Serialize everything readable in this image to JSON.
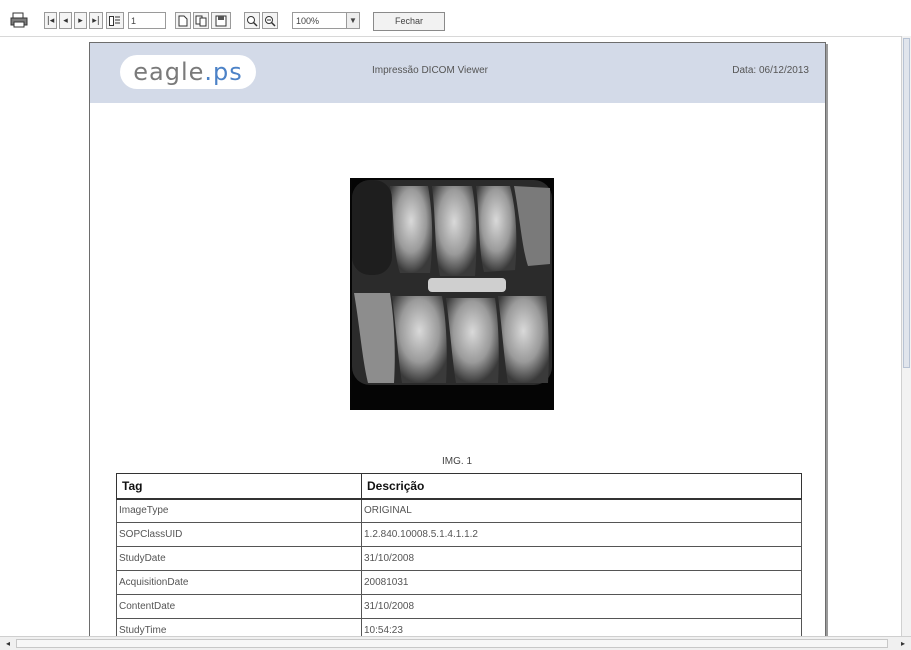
{
  "toolbar": {
    "page_number": "1",
    "zoom_value": "100%",
    "close_label": "Fechar",
    "nav_first": "|◂",
    "nav_prev": "◂",
    "nav_next": "▸",
    "nav_last": "▸|"
  },
  "report": {
    "logo_main": "eagle",
    "logo_dot": ".",
    "logo_suffix": "ps",
    "title": "Impressão DICOM Viewer",
    "date": "Data: 06/12/2013",
    "image_caption": "IMG. 1",
    "table": {
      "headers": [
        "Tag",
        "Descrição"
      ],
      "rows": [
        [
          "ImageType",
          "ORIGINAL"
        ],
        [
          "SOPClassUID",
          "1.2.840.10008.5.1.4.1.1.2"
        ],
        [
          "StudyDate",
          "31/10/2008"
        ],
        [
          "AcquisitionDate",
          "20081031"
        ],
        [
          "ContentDate",
          "31/10/2008"
        ],
        [
          "StudyTime",
          "10:54:23"
        ]
      ]
    }
  },
  "colors": {
    "header_band": "#d3dae8",
    "logo_accent": "#4c82c7"
  }
}
